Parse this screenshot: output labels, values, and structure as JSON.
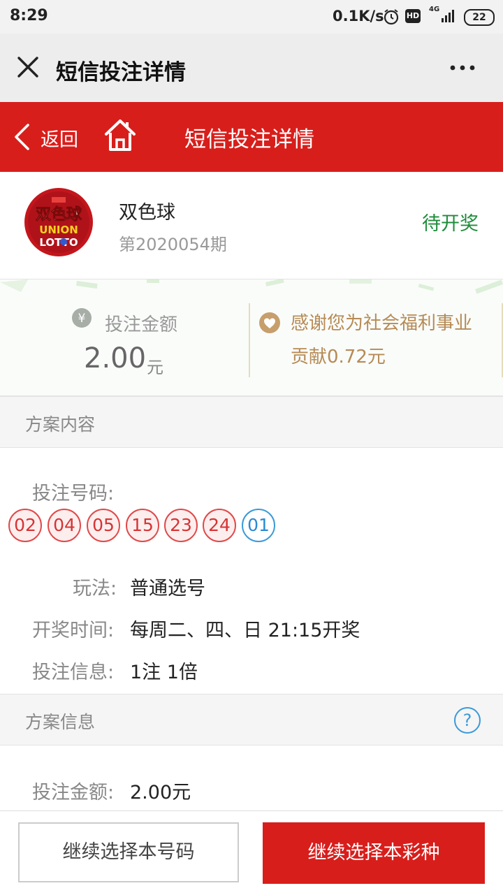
{
  "status_bar": {
    "time": "8:29",
    "speed": "0.1K/s",
    "battery": "22",
    "hd": "HD",
    "network": "4G"
  },
  "app_bar": {
    "title": "短信投注详情"
  },
  "header": {
    "back_label": "返回",
    "title": "短信投注详情"
  },
  "lottery": {
    "name": "双色球",
    "issue": "第2020054期",
    "status": "待开奖",
    "status_color": "#1f8c3b",
    "logo_text_top": "双色球",
    "logo_text_mid": "UNION",
    "logo_text_bot": "LOTTO"
  },
  "amount": {
    "label": "投注金额",
    "value": "2.00",
    "unit": "元",
    "currency_icon": "¥",
    "thanks_line1": "感谢您为社会福利事业",
    "thanks_line2": "贡献0.72元"
  },
  "plan_content": {
    "section_title": "方案内容",
    "numbers_label": "投注号码:",
    "red_balls": [
      "02",
      "04",
      "05",
      "15",
      "23",
      "24"
    ],
    "blue_balls": [
      "01"
    ],
    "play_label": "玩法:",
    "play_value": "普通选号",
    "draw_time_label": "开奖时间:",
    "draw_time_value": "每周二、四、日 21:15开奖",
    "bet_info_label": "投注信息:",
    "bet_info_value": "1注 1倍"
  },
  "plan_info": {
    "section_title": "方案信息",
    "help_icon": "?",
    "amount_label": "投注金额:",
    "amount_value": "2.00元"
  },
  "bottom": {
    "continue_numbers": "继续选择本号码",
    "continue_lottery": "继续选择本彩种"
  },
  "colors": {
    "brand_red": "#d81e1b",
    "ball_red": "#d63434",
    "ball_blue": "#2a8ad3"
  }
}
